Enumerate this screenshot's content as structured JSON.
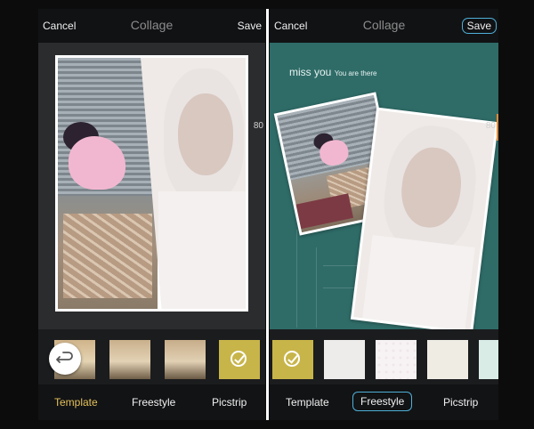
{
  "left": {
    "cancel_label": "Cancel",
    "title": "Collage",
    "save_label": "Save",
    "zoom_value": "80",
    "tabs": [
      "Template",
      "Freestyle",
      "Picstrip"
    ],
    "active_tab": "Template"
  },
  "right": {
    "cancel_label": "Cancel",
    "title": "Collage",
    "save_label": "Save",
    "zoom_value": "80",
    "background_text_main": "miss you",
    "background_text_sub": "You are there",
    "tabs": [
      "Template",
      "Freestyle",
      "Picstrip"
    ],
    "active_tab": "Freestyle"
  },
  "colors": {
    "accent_yellow": "#e3c15a",
    "accent_blue": "#4fb0d8",
    "selected_swatch": "#c8b54a",
    "teal_background": "#2f6c68",
    "zoom_marker": "#e08a3a"
  },
  "icons": [
    "back-arrow-icon",
    "checkmark-icon"
  ]
}
